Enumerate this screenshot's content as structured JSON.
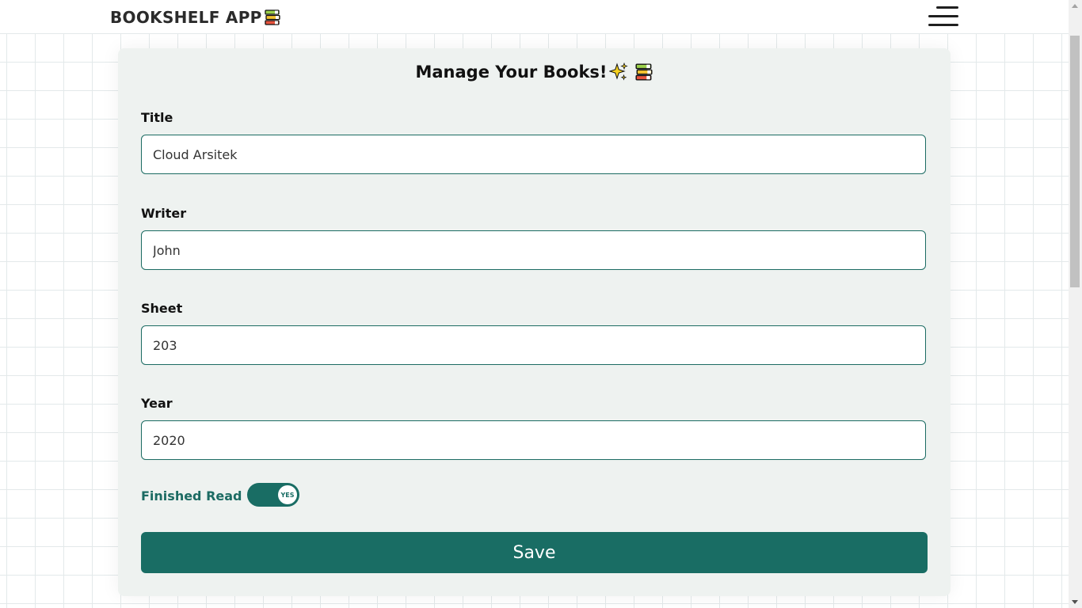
{
  "header": {
    "app_title": "BOOKSHELF APP",
    "brand_icon": "books-icon",
    "menu_icon": "hamburger-menu-icon"
  },
  "form": {
    "heading": "Manage Your Books!",
    "heading_icons": [
      "sparkles-icon",
      "books-icon"
    ],
    "fields": [
      {
        "label": "Title",
        "value": "Cloud Arsitek"
      },
      {
        "label": "Writer",
        "value": "John"
      },
      {
        "label": "Sheet",
        "value": "203"
      },
      {
        "label": "Year",
        "value": "2020"
      }
    ],
    "toggle": {
      "label": "Finished Read",
      "state_text": "YES",
      "checked": true
    },
    "save_label": "Save"
  },
  "colors": {
    "accent": "#196d64",
    "card_background": "#eef2f0",
    "grid_line": "#e3e9ea"
  }
}
